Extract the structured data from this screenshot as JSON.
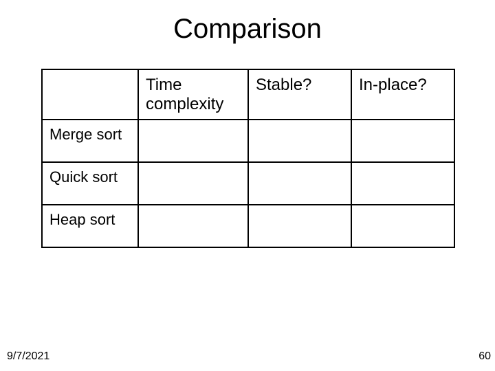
{
  "title": "Comparison",
  "table": {
    "headers": [
      "",
      "Time complexity",
      "Stable?",
      "In-place?"
    ],
    "rows": [
      {
        "label": "Merge sort",
        "cells": [
          "",
          "",
          ""
        ]
      },
      {
        "label": "Quick sort",
        "cells": [
          "",
          "",
          ""
        ]
      },
      {
        "label": "Heap sort",
        "cells": [
          "",
          "",
          ""
        ]
      }
    ]
  },
  "footer": {
    "date": "9/7/2021",
    "page": "60"
  }
}
